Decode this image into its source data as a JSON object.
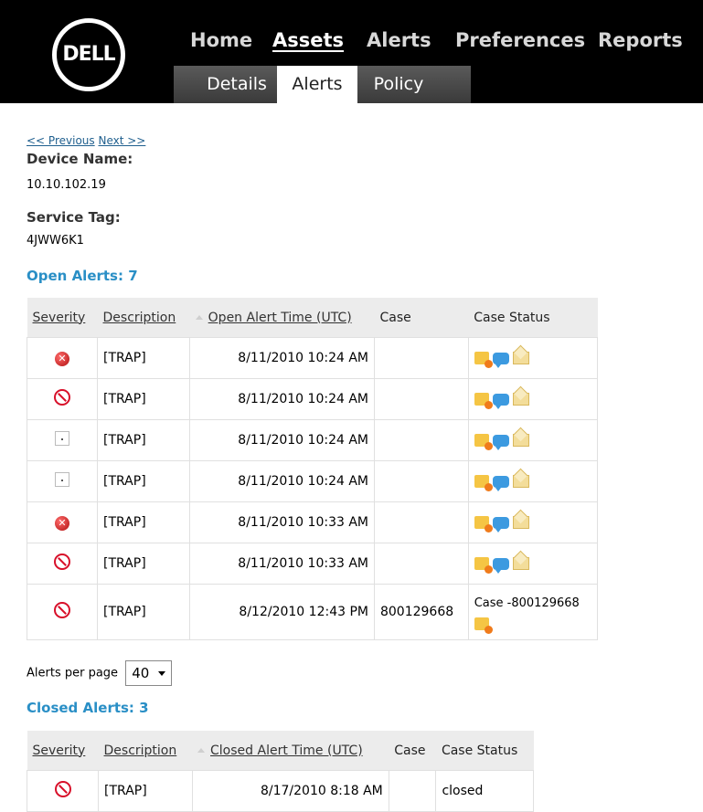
{
  "header": {
    "logo": "DELL",
    "nav": [
      "Home",
      "Assets",
      "Alerts",
      "Preferences",
      "Reports"
    ],
    "active_nav": "Assets",
    "subtabs": [
      "Details",
      "Alerts",
      "Policy"
    ],
    "active_subtab": "Alerts"
  },
  "pager": {
    "previous": "<< Previous",
    "next": "Next >>"
  },
  "device": {
    "name_label": "Device Name:",
    "name_value": "10.10.102.19",
    "tag_label": "Service Tag:",
    "tag_value": "4JWW6K1"
  },
  "open_alerts": {
    "title": "Open Alerts: 7",
    "columns": [
      "Severity",
      "Description",
      "Open Alert Time (UTC)",
      "Case",
      "Case Status"
    ],
    "rows": [
      {
        "severity": "critical-icon",
        "description": "[TRAP]",
        "time": "8/11/2010 10:24 AM",
        "case": "",
        "status": ""
      },
      {
        "severity": "warning-icon",
        "description": "[TRAP]",
        "time": "8/11/2010 10:24 AM",
        "case": "",
        "status": ""
      },
      {
        "severity": "unknown-icon",
        "description": "[TRAP]",
        "time": "8/11/2010 10:24 AM",
        "case": "",
        "status": ""
      },
      {
        "severity": "unknown-icon",
        "description": "[TRAP]",
        "time": "8/11/2010 10:24 AM",
        "case": "",
        "status": ""
      },
      {
        "severity": "critical-icon",
        "description": "[TRAP]",
        "time": "8/11/2010 10:33 AM",
        "case": "",
        "status": ""
      },
      {
        "severity": "warning-icon",
        "description": "[TRAP]",
        "time": "8/11/2010 10:33 AM",
        "case": "",
        "status": ""
      },
      {
        "severity": "warning-icon",
        "description": "[TRAP]",
        "time": "8/12/2010 12:43 PM",
        "case": "800129668",
        "status": "Case -800129668"
      }
    ]
  },
  "per_page": {
    "label": "Alerts per page",
    "value": "40"
  },
  "closed_alerts": {
    "title": "Closed Alerts: 3",
    "columns": [
      "Severity",
      "Description",
      "Closed Alert Time (UTC)",
      "Case",
      "Case Status"
    ],
    "rows": [
      {
        "severity": "warning-icon",
        "description": "[TRAP]",
        "time": "8/17/2010 8:18 AM",
        "case": "",
        "status": "closed"
      }
    ]
  }
}
